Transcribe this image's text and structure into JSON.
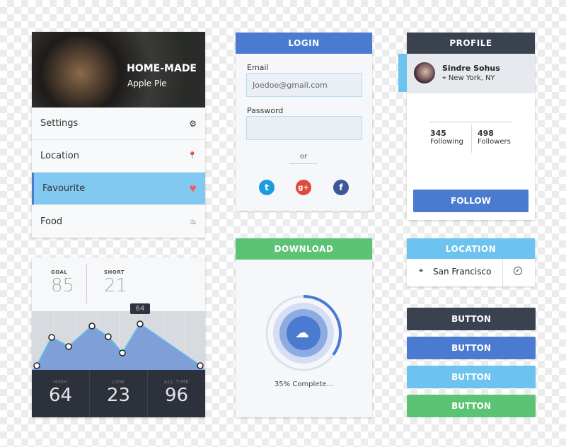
{
  "menu_card": {
    "hero_title": "HOME-MADE",
    "hero_subtitle": "Apple Pie",
    "items": [
      {
        "label": "Settings",
        "icon": "gear-icon"
      },
      {
        "label": "Location",
        "icon": "pin-icon"
      },
      {
        "label": "Favourite",
        "icon": "heart-icon",
        "active": true
      },
      {
        "label": "Food",
        "icon": "pot-icon"
      }
    ]
  },
  "login": {
    "title": "LOGIN",
    "email_label": "Email",
    "email_value": "Joedoe@gmail.com",
    "password_label": "Password",
    "password_value": "",
    "or": "or",
    "social": [
      "twitter-icon",
      "google-plus-icon",
      "facebook-icon"
    ]
  },
  "profile": {
    "title": "PROFILE",
    "name": "Sindre Sohus",
    "location": "New York, NY",
    "following_count": "345",
    "following_label": "Following",
    "followers_count": "498",
    "followers_label": "Followers",
    "follow_button": "FOLLOW"
  },
  "stats": {
    "goal_label": "GOAL",
    "goal_value": "85",
    "short_label": "SHORT",
    "short_value": "21",
    "tooltip": "64",
    "high_label": "HIGH",
    "high_value": "64",
    "low_label": "LOW",
    "low_value": "23",
    "alltime_label": "ALL TIME",
    "alltime_value": "96"
  },
  "chart_data": {
    "type": "area",
    "values": [
      5,
      45,
      32,
      61,
      46,
      23,
      64,
      5
    ],
    "highlight_index": 6,
    "color": "#7f9fd6",
    "line_color": "#5fb8ec"
  },
  "download": {
    "title": "DOWNLOAD",
    "progress_percent": 35,
    "status": "35% Complete..."
  },
  "location": {
    "title": "LOCATION",
    "value": "San Francisco"
  },
  "buttons": [
    {
      "label": "BUTTON",
      "color": "#3a4250"
    },
    {
      "label": "BUTTON",
      "color": "#4a7bd0"
    },
    {
      "label": "BUTTON",
      "color": "#6cc3f0"
    },
    {
      "label": "BUTTON",
      "color": "#5cc375"
    }
  ],
  "colors": {
    "blue": "#4a7bd0",
    "green": "#5cc375",
    "dark": "#3a4250",
    "light_blue": "#6cc3f0"
  }
}
